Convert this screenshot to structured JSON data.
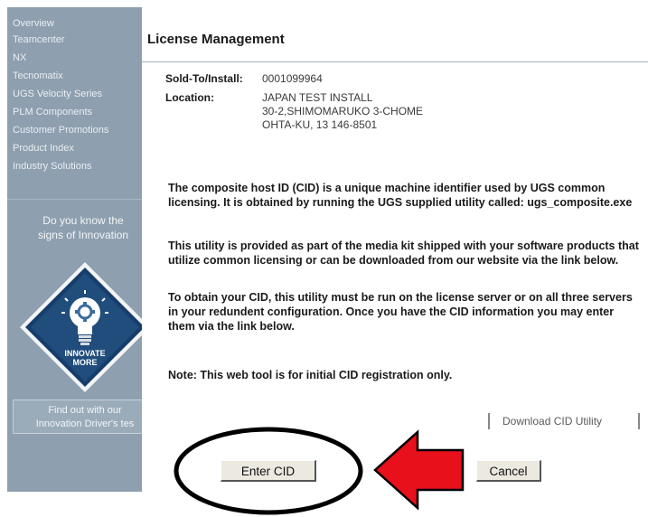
{
  "sidebar": {
    "nav_items": [
      "Overview",
      "Teamcenter",
      "NX",
      "Tecnomatix",
      "UGS Velocity Series",
      "PLM Components",
      "Customer Promotions",
      "Product Index",
      "Industry Solutions"
    ],
    "promo_line1": "Do you know the",
    "promo_line2": "signs of Innovation",
    "badge_line1": "INNOVATE",
    "badge_line2": "MORE",
    "find_line1": "Find out with our",
    "find_line2": "Innovation Driver's tes"
  },
  "page": {
    "title": "License Management"
  },
  "account": {
    "sold_to_label": "Sold-To/Install:",
    "sold_to_value": "0001099964",
    "location_label": "Location:",
    "location_line1": "JAPAN TEST INSTALL",
    "location_line2": "30-2,SHIMOMARUKO 3-CHOME",
    "location_line3": "OHTA-KU, 13 146-8501"
  },
  "content": {
    "para1": "The composite host ID (CID) is a unique machine identifier used by UGS common licensing. It is obtained by running the UGS supplied utility called: ugs_composite.exe",
    "para2": "This utility is provided as part of the media kit shipped with your software products that utilize common licensing or can be downloaded from our website via the link below.",
    "para3": "To obtain your CID, this utility must be run on the license server or on all three servers in your redundent configuration. Once you have the CID information you may enter them via the link below.",
    "note": "Note: This web tool is for initial CID registration only."
  },
  "actions": {
    "download_label": "Download CID Utility",
    "enter_cid_label": "Enter CID",
    "cancel_label": "Cancel"
  },
  "annotation": {
    "ellipse_color": "#000000",
    "arrow_color": "#e8101a"
  },
  "icons": [
    "lightbulb-diamond-badge",
    "red-arrow-left"
  ]
}
